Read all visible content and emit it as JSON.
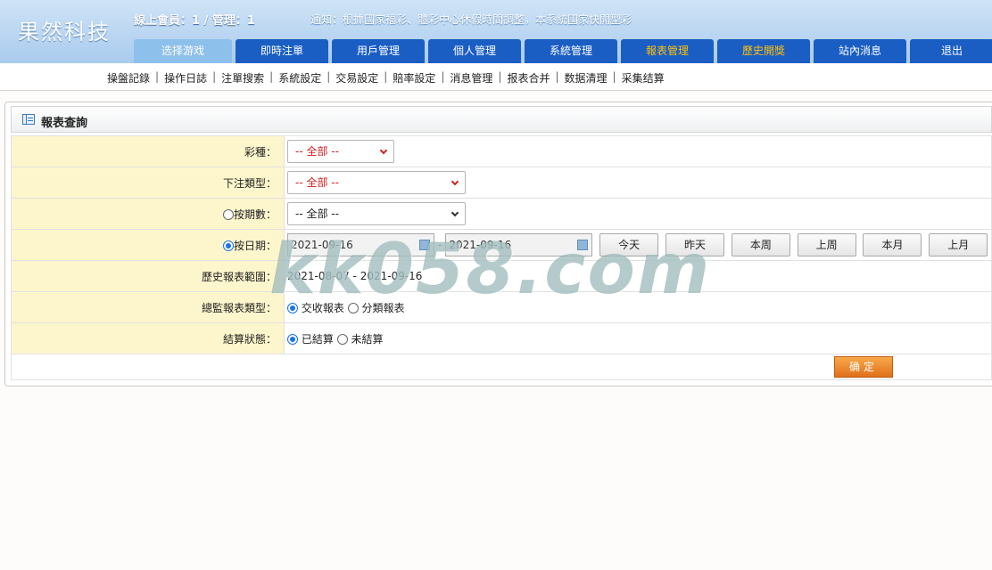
{
  "header": {
    "logo": "果然科技",
    "online": "線上會員：1 / 管理：1",
    "notice": "通知：根據國家福彩、體彩中心休假時間調整，本系統國家快開型彩"
  },
  "nav": [
    {
      "label": "选择游戏"
    },
    {
      "label": "即時注單"
    },
    {
      "label": "用戶管理"
    },
    {
      "label": "個人管理"
    },
    {
      "label": "系統管理"
    },
    {
      "label": "報表管理"
    },
    {
      "label": "歷史開獎"
    },
    {
      "label": "站內消息"
    },
    {
      "label": "退出"
    }
  ],
  "subnav": [
    "操盤記錄",
    "操作日誌",
    "注單搜索",
    "系統設定",
    "交易設定",
    "賠率設定",
    "消息管理",
    "报表合并",
    "数据清理",
    "采集结算"
  ],
  "panel": {
    "title": "報表查詢",
    "rows": {
      "lottery": {
        "label": "彩種：",
        "value": "-- 全部 --"
      },
      "bet_type": {
        "label": "下注類型：",
        "value": "-- 全部 --"
      },
      "period": {
        "label": "按期數：",
        "value": "-- 全部 --"
      },
      "date": {
        "label": "按日期：",
        "from": "2021-09-16",
        "to": "2021-09-16",
        "dash": "-",
        "buttons": [
          "今天",
          "昨天",
          "本周",
          "上周",
          "本月",
          "上月"
        ]
      },
      "range": {
        "label": "歷史報表範圍：",
        "value": "2021-08-07 - 2021-09-16"
      },
      "report_type": {
        "label": "總監報表類型：",
        "opt1": "交收報表",
        "opt2": "分類報表"
      },
      "settle": {
        "label": "結算狀態：",
        "opt1": "已結算",
        "opt2": "未結算"
      }
    },
    "confirm": "确定"
  },
  "watermark": "kk058.com"
}
